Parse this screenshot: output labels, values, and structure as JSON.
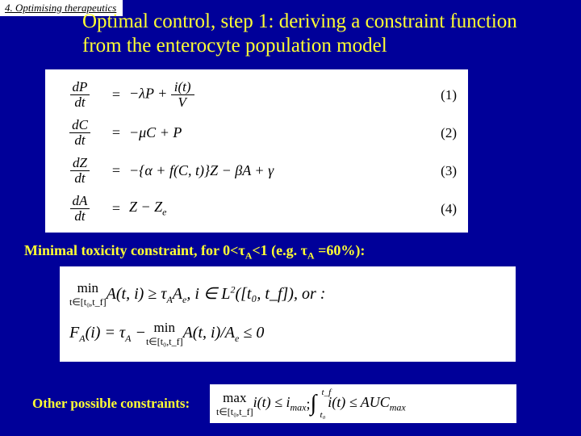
{
  "tab": "4. Optimising therapeutics",
  "title": "Optimal control, step 1: deriving a constraint function from the enterocyte population model",
  "equations": {
    "rows": [
      {
        "lhs_num": "dP",
        "lhs_den": "dt",
        "rhs_html": "eq1",
        "num": "(1)"
      },
      {
        "lhs_num": "dC",
        "lhs_den": "dt",
        "rhs_html": "eq2",
        "num": "(2)"
      },
      {
        "lhs_num": "dZ",
        "lhs_den": "dt",
        "rhs_html": "eq3",
        "num": "(3)"
      },
      {
        "lhs_num": "dA",
        "lhs_den": "dt",
        "rhs_html": "eq4",
        "num": "(4)"
      }
    ],
    "eq1_a": "−λP +",
    "eq1_frac_n": "i(t)",
    "eq1_frac_d": "V",
    "eq2": "−μC + P",
    "eq3": "−{α + f(C, t)}Z − βA + γ",
    "eq4_a": "Z − Z",
    "eq4_sub": "e"
  },
  "constraint_label_a": "Minimal toxicity constraint, for 0<τ",
  "constraint_label_b": "<1 (e.g. τ",
  "constraint_label_c": " =60%):",
  "constraint_sub": "A",
  "box2": {
    "line1_min_top": "min",
    "line1_min_bot": "t∈[t₀,t_f]",
    "line1_a": " A(t, i) ≥ τ",
    "line1_b": "A",
    "line1_c": "A",
    "line1_csub": "e",
    "line1_d": ", i ∈ L",
    "line1_sup": "2",
    "line1_e": "([t₀, t_f]), or :",
    "line2_a": "F",
    "line2_asub": "A",
    "line2_b": "(i) = τ",
    "line2_bsub": "A",
    "line2_c": " − ",
    "line2_min_top": "min",
    "line2_min_bot": "t∈[t₀,t_f]",
    "line2_d": " A(t, i)/A",
    "line2_dsub": "e",
    "line2_e": " ≤ 0"
  },
  "other_label": "Other possible constraints:",
  "box3": {
    "max_top": "max",
    "max_bot": "t∈[t₀,t_f]",
    "a": " i(t) ≤ i",
    "a_sub": "max",
    "sep": " ; ",
    "int_hi": "t_f",
    "int_lo": "t₀",
    "b": " i(t) ≤ AUC",
    "b_sub": "max"
  }
}
